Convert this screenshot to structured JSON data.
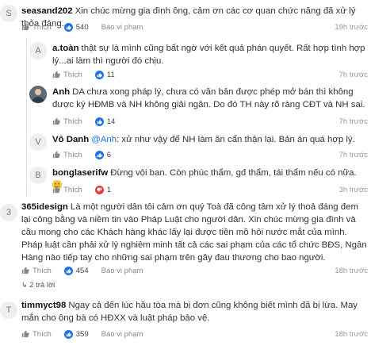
{
  "ui": {
    "like_label": "Thích",
    "report_label": "Báo vi phạm",
    "replies_label": "2 trả lời"
  },
  "comments": [
    {
      "initial": "S",
      "author": "seasand202",
      "text": "Xin chúc mừng gia đình ông, cảm ơn các cơ quan chức năng đã xử lý thỏa đáng.",
      "likes": "540",
      "time": "19h trước"
    },
    {
      "initial": "A",
      "author": "a.toàn",
      "text": "thật sự là mình cũng bất ngờ với kết quả phán quyết. Rất hợp tình hợp lý...ai làm thì người đó chịu.",
      "likes": "11",
      "time": "7h trước"
    },
    {
      "initial": "",
      "author": "Anh",
      "text": "DA chưa xong pháp lý, chưa có văn bản được phép mở bán thì không được ký HĐMB và NH không giải ngân. Do đó TH này rõ ràng CĐT và NH sai.",
      "likes": "14",
      "time": "7h trước"
    },
    {
      "initial": "V",
      "author": "Vô Danh",
      "mention": "@Anh",
      "text": ": xử như vậy để NH làm ăn cẩn thận lại. Bản án quá hợp lý.",
      "likes": "6",
      "time": "7h trước"
    },
    {
      "initial": "B",
      "author": "bonglaserifw",
      "text": "Đừng vội ban. Còn phúc thẩm, gđ thẩm, tái thẩm nếu có nữa.",
      "likes": "1",
      "time": "3h trước"
    },
    {
      "initial": "3",
      "author": "365idesign",
      "text": "Là một người dân tôi cảm ơn quý Toà đã công tâm xử lý thoả đáng đem lại công bằng và niềm tin vào Pháp Luật cho người dân. Xin chúc mừng gia đình và cầu mong cho các Khách hàng khác lấy lại được tiền mồ hôi nước mắt của mình. Pháp luật cần phải xử lý nghiêm minh tất cả các sai phạm của các tổ chức BĐS, Ngân Hàng nào tiếp tay cho những sai phạm trên gây đau thương cho bao người.",
      "likes": "454",
      "time": "18h trước"
    },
    {
      "initial": "T",
      "author": "timmyct98",
      "text": "Ngay cả đến lúc hầu tòa mà bị đơn cũng không biết mình đã bị lừa. May mắn cho ông bà có HĐXX và luật pháp bảo vệ.",
      "likes": "359",
      "time": "18h trước"
    }
  ]
}
